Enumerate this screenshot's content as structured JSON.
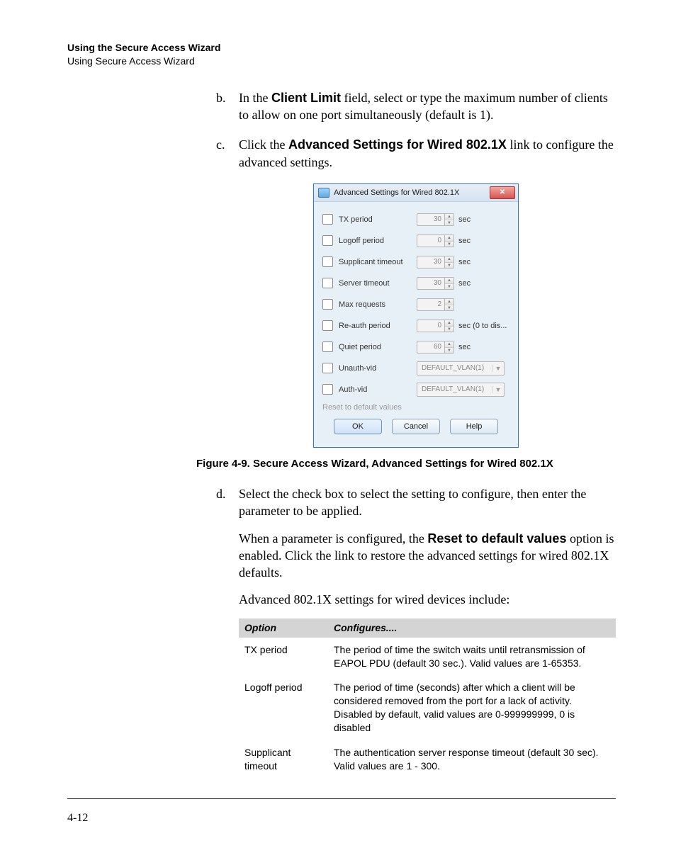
{
  "header": {
    "line1": "Using the Secure Access Wizard",
    "line2": "Using Secure Access Wizard"
  },
  "steps": {
    "b": {
      "marker": "b.",
      "pre": "In the ",
      "bold": "Client Limit",
      "post": " field, select or type the maximum number of clients to allow on one port simultaneously (default is 1)."
    },
    "c": {
      "marker": "c.",
      "pre": "Click the ",
      "bold": "Advanced Settings for Wired 802.1X",
      "post": " link to configure the advanced settings."
    }
  },
  "dialog": {
    "title": "Advanced Settings for Wired 802.1X",
    "rows": [
      {
        "label": "TX period",
        "value": "30",
        "unit": "sec",
        "type": "spin"
      },
      {
        "label": "Logoff period",
        "value": "0",
        "unit": "sec",
        "type": "spin"
      },
      {
        "label": "Supplicant timeout",
        "value": "30",
        "unit": "sec",
        "type": "spin"
      },
      {
        "label": "Server timeout",
        "value": "30",
        "unit": "sec",
        "type": "spin"
      },
      {
        "label": "Max requests",
        "value": "2",
        "unit": "",
        "type": "spin"
      },
      {
        "label": "Re-auth period",
        "value": "0",
        "unit": "sec (0 to dis...",
        "type": "spin"
      },
      {
        "label": "Quiet period",
        "value": "60",
        "unit": "sec",
        "type": "spin"
      },
      {
        "label": "Unauth-vid",
        "value": "DEFAULT_VLAN(1)",
        "type": "combo"
      },
      {
        "label": "Auth-vid",
        "value": "DEFAULT_VLAN(1)",
        "type": "combo"
      }
    ],
    "reset": "Reset to default values",
    "buttons": {
      "ok": "OK",
      "cancel": "Cancel",
      "help": "Help"
    }
  },
  "figure_caption": "Figure 4-9. Secure Access Wizard, Advanced Settings for Wired 802.1X",
  "step_d": {
    "marker": "d.",
    "p1": "Select the check box to select the setting to configure, then enter the parameter to be applied.",
    "p2_pre": "When a parameter is configured, the ",
    "p2_bold": "Reset to default values",
    "p2_post": " option is enabled. Click the link to restore the advanced settings for wired 802.1X defaults.",
    "p3": "Advanced 802.1X settings for wired devices include:"
  },
  "table": {
    "h1": "Option",
    "h2": "Configures....",
    "rows": [
      {
        "opt": "TX period",
        "cfg": "The period of time the switch waits until retransmission of EAPOL PDU (default 30 sec.). Valid values are 1-65353."
      },
      {
        "opt": "Logoff period",
        "cfg": "The period of time (seconds) after which a client will be considered removed from the port for a lack of activity. Disabled by default, valid values are 0-999999999, 0 is disabled"
      },
      {
        "opt": "Supplicant timeout",
        "cfg": "The authentication server response timeout (default 30 sec). Valid values are 1 - 300."
      }
    ]
  },
  "page_number": "4-12"
}
